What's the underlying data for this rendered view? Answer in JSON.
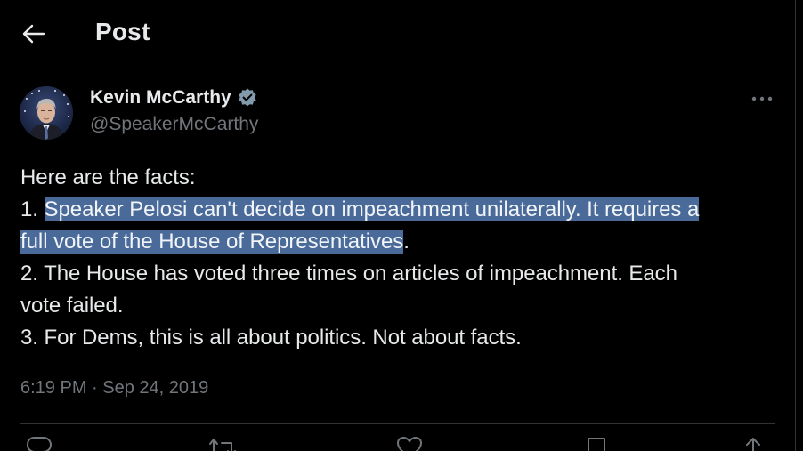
{
  "header": {
    "back_icon": "arrow-left-icon",
    "title": "Post"
  },
  "author": {
    "name": "Kevin McCarthy",
    "handle": "@SpeakerMcCarthy",
    "verified_icon": "verified-badge-icon",
    "verified_color": "#829aab"
  },
  "more_icon": "more-horizontal-icon",
  "tweet": {
    "line1": "Here are the facts:",
    "line2_prefix": "1. ",
    "line2_highlight": "Speaker Pelosi can't decide on impeachment unilaterally. It requires a",
    "line3_highlight": "full vote of the House of Representatives",
    "line3_suffix": ".",
    "line4": "2. The House has voted three times on articles of impeachment. Each",
    "line5": "vote failed.",
    "line6": "3. For Dems, this is all about politics. Not about facts.",
    "highlight_color": "#4a6a9a"
  },
  "meta": {
    "time": "6:19 PM",
    "separator": "·",
    "date": "Sep 24, 2019"
  },
  "actions": [
    {
      "icon": "reply-icon"
    },
    {
      "icon": "repost-icon"
    },
    {
      "icon": "like-icon"
    },
    {
      "icon": "bookmark-icon"
    },
    {
      "icon": "share-icon"
    }
  ],
  "colors": {
    "background": "#000000",
    "text": "#e7e9ea",
    "secondary": "#71767b",
    "border": "#2f3336"
  }
}
